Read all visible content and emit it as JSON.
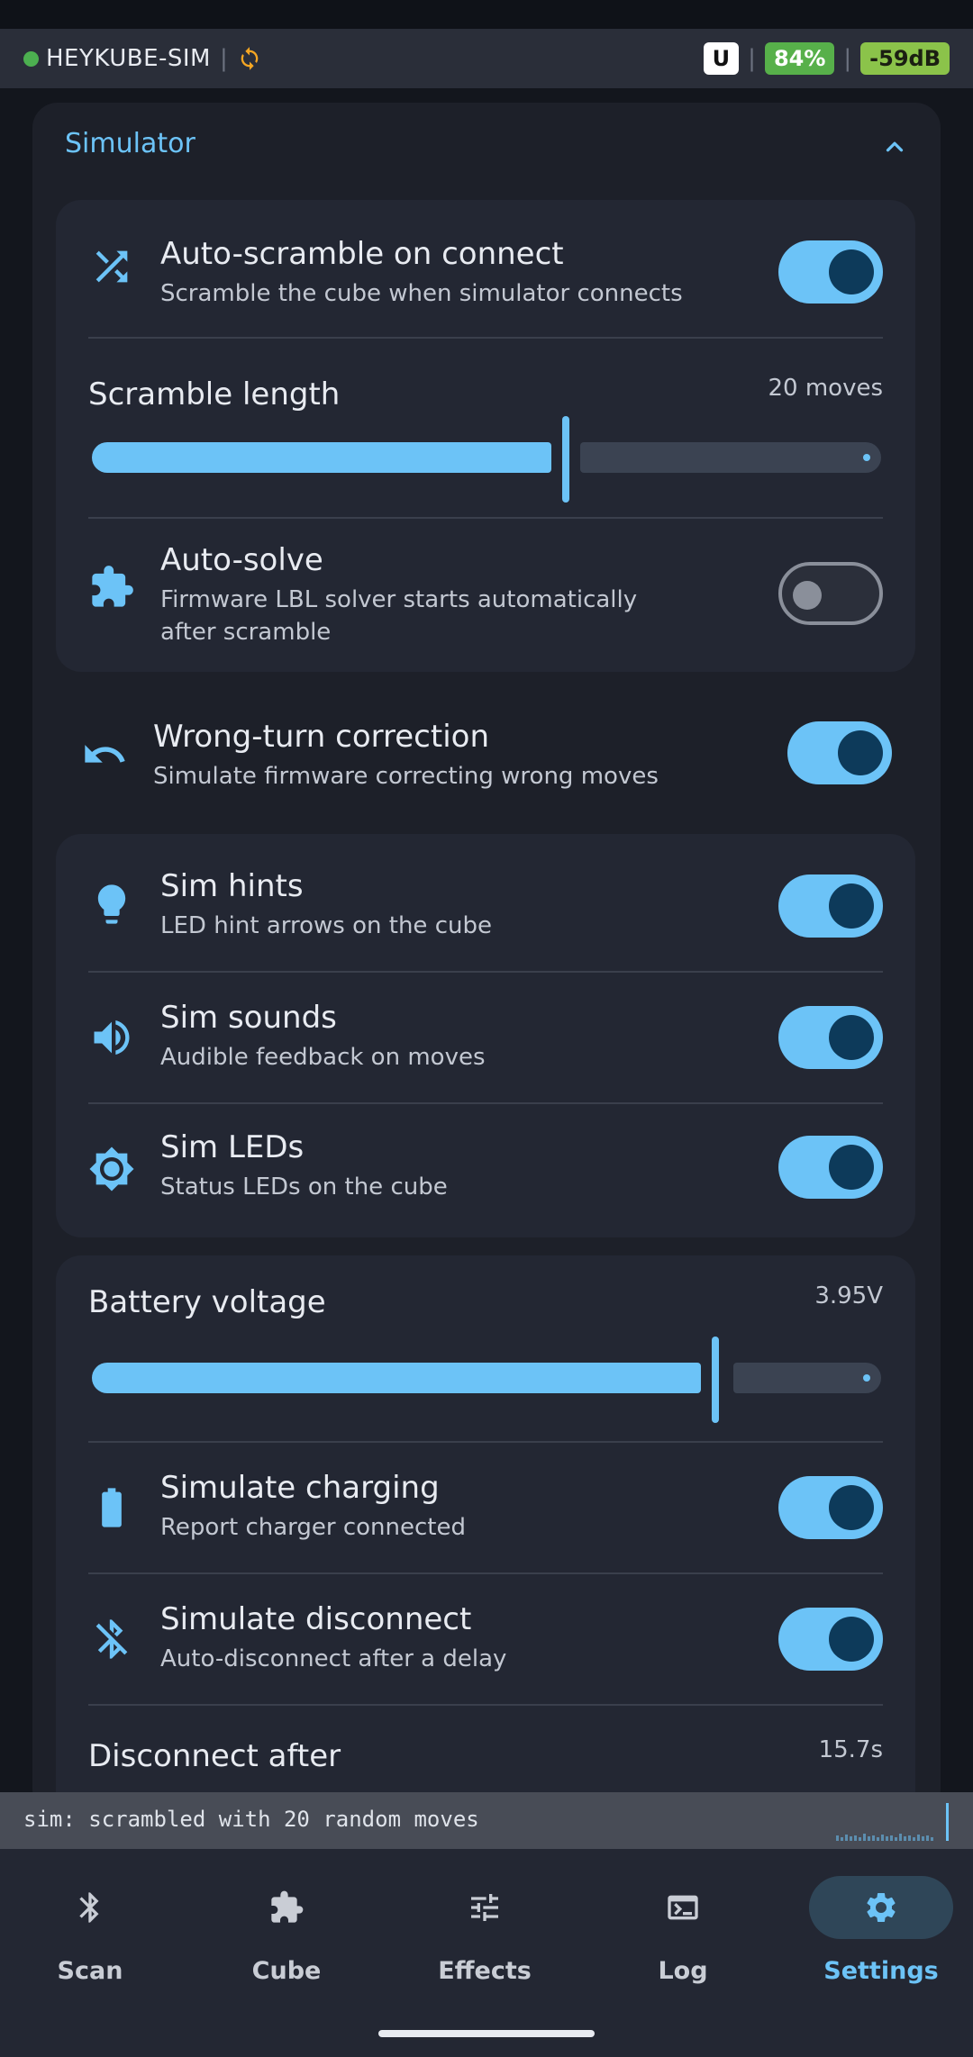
{
  "status": {
    "device_name": "HEYKUBE-SIM",
    "separator": "|",
    "badge_u": "U",
    "battery": "84%",
    "signal": "-59dB",
    "colors": {
      "connected": "#4caf50",
      "battery": "#57b04a",
      "signal": "#8bc34a",
      "sync": "#f5a623"
    }
  },
  "section": {
    "title": "Simulator"
  },
  "settings": {
    "auto_scramble": {
      "title": "Auto-scramble on connect",
      "sub": "Scramble the cube when simulator connects",
      "on": true
    },
    "scramble_length": {
      "label": "Scramble length",
      "value": "20 moves",
      "fraction": 0.6
    },
    "auto_solve": {
      "title": "Auto-solve",
      "sub": "Firmware LBL solver starts automatically after scramble",
      "on": false
    },
    "wrong_turn": {
      "title": "Wrong-turn correction",
      "sub": "Simulate firmware correcting wrong moves",
      "on": true
    },
    "sim_hints": {
      "title": "Sim hints",
      "sub": "LED hint arrows on the cube",
      "on": true
    },
    "sim_sounds": {
      "title": "Sim sounds",
      "sub": "Audible feedback on moves",
      "on": true
    },
    "sim_leds": {
      "title": "Sim LEDs",
      "sub": "Status LEDs on the cube",
      "on": true
    },
    "battery_voltage": {
      "label": "Battery voltage",
      "value": "3.95V",
      "fraction": 0.79
    },
    "sim_charging": {
      "title": "Simulate charging",
      "sub": "Report charger connected",
      "on": true
    },
    "sim_disconnect": {
      "title": "Simulate disconnect",
      "sub": "Auto-disconnect after a delay",
      "on": true
    },
    "disconnect_after": {
      "label": "Disconnect after",
      "value": "15.7s"
    }
  },
  "console": {
    "message": "sim: scrambled with 20 random moves"
  },
  "nav": {
    "items": [
      {
        "label": "Scan",
        "icon": "bluetooth-icon"
      },
      {
        "label": "Cube",
        "icon": "puzzle-icon"
      },
      {
        "label": "Effects",
        "icon": "sliders-icon"
      },
      {
        "label": "Log",
        "icon": "terminal-icon"
      },
      {
        "label": "Settings",
        "icon": "gear-icon",
        "active": true
      }
    ]
  },
  "theme": {
    "accent": "#6cc3f7",
    "panel": "#1d2029",
    "card": "#232733"
  }
}
